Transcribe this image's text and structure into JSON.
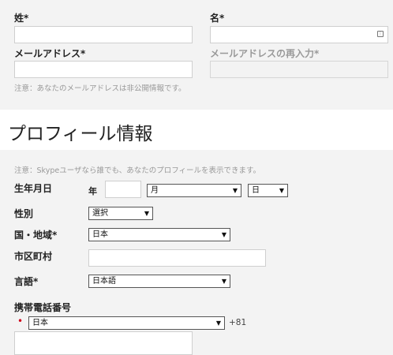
{
  "name": {
    "last_name_label": "姓*",
    "first_name_label": "名*"
  },
  "email": {
    "email_label": "メールアドレス*",
    "email_confirm_label": "メールアドレスの再入力*",
    "note": "注意：あなたのメールアドレスは非公開情報です。"
  },
  "profile": {
    "title": "プロフィール情報",
    "note": "注意：Skypeユーザなら誰でも、あなたのプロフィールを表示できます。",
    "birthdate": {
      "label": "生年月日",
      "year_label": "年",
      "month_value": "月",
      "day_value": "日"
    },
    "gender": {
      "label": "性別",
      "value": "選択"
    },
    "country": {
      "label": "国・地域*",
      "value": "日本"
    },
    "city": {
      "label": "市区町村"
    },
    "language": {
      "label": "言語*",
      "value": "日本語"
    },
    "mobile": {
      "label": "携帯電話番号",
      "required_mark": "•",
      "country_value": "日本",
      "country_code": "+81"
    }
  },
  "icons": {
    "select_arrow": "▼",
    "keyboard": "keyboard-icon"
  }
}
